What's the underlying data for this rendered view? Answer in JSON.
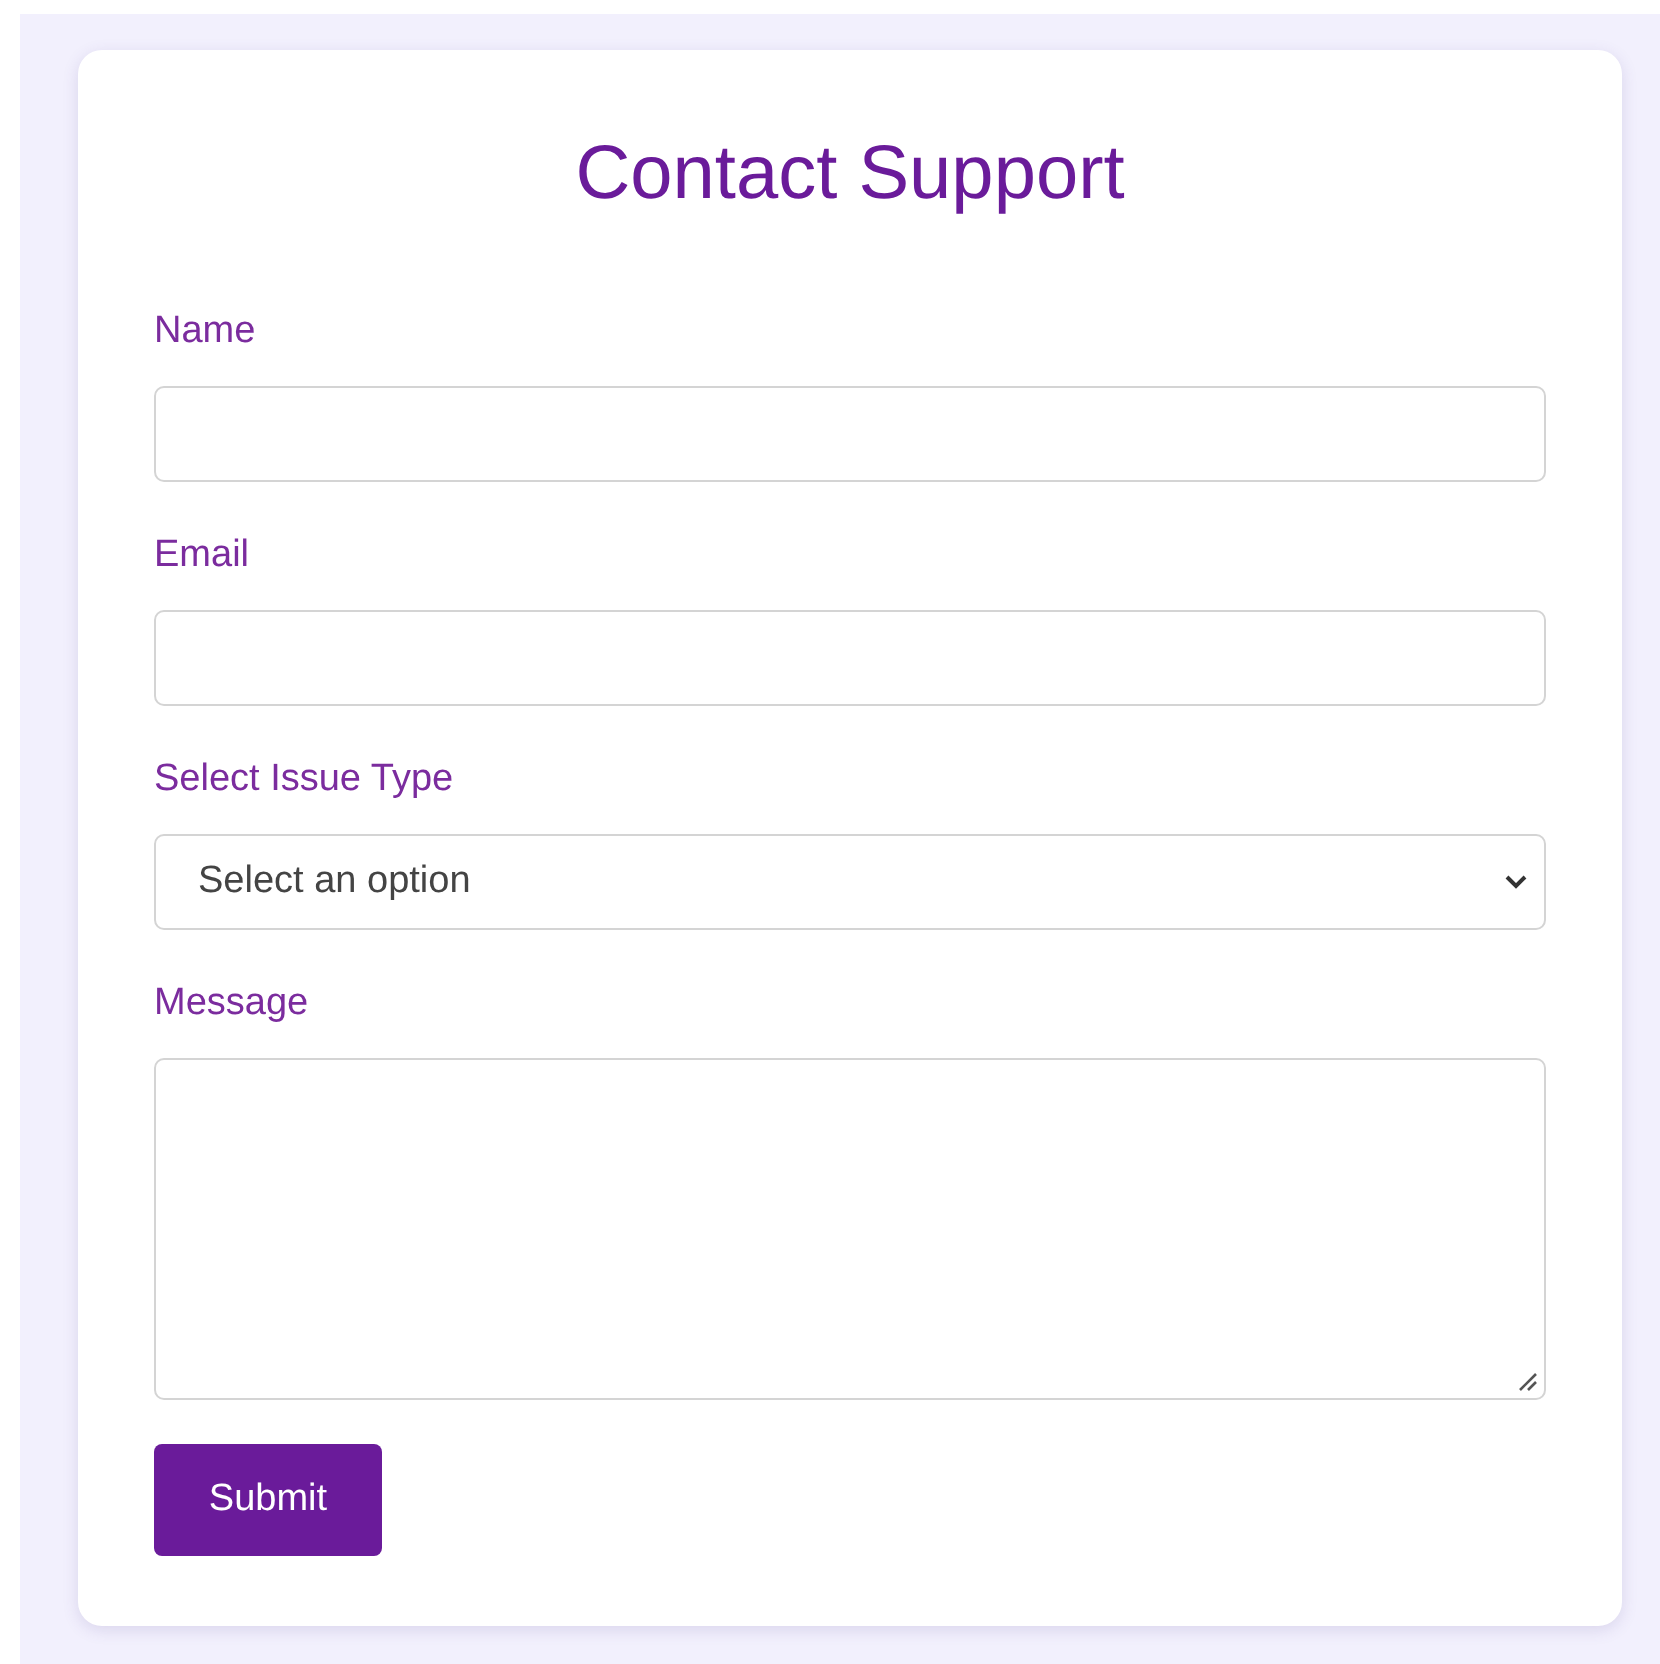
{
  "form": {
    "title": "Contact Support",
    "fields": [
      {
        "kind": "text",
        "label": "Name"
      },
      {
        "kind": "text",
        "label": "Email"
      },
      {
        "kind": "select",
        "label": "Select Issue Type",
        "value": "Select an option"
      },
      {
        "kind": "textarea",
        "label": "Message"
      }
    ],
    "submit_button": "Submit"
  }
}
